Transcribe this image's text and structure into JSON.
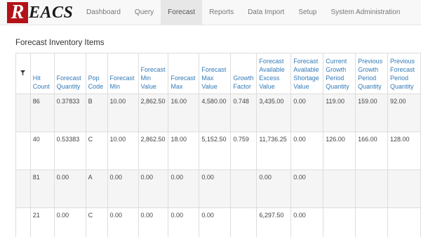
{
  "app": {
    "logo_letter": "R",
    "logo_rest": "EACS"
  },
  "nav": [
    {
      "label": "Dashboard",
      "active": false
    },
    {
      "label": "Query",
      "active": false
    },
    {
      "label": "Forecast",
      "active": true
    },
    {
      "label": "Reports",
      "active": false
    },
    {
      "label": "Data Import",
      "active": false
    },
    {
      "label": "Setup",
      "active": false
    },
    {
      "label": "System Administration",
      "active": false
    }
  ],
  "section": {
    "title": "Forecast Inventory Items"
  },
  "table": {
    "columns": [
      "Hit Count",
      "Forecast Quantity",
      "Pop Code",
      "Forecast Min",
      "Forecast Min Value",
      "Forecast Max",
      "Forecast Max Value",
      "Growth Factor",
      "Forecast Available Excess Value",
      "Forecast Available Shortage Value",
      "Current Growth Period Quantity",
      "Previous Growth Period Quantity",
      "Previous Forecast Period Quantity"
    ],
    "rows": [
      [
        "86",
        "0.37833",
        "B",
        "10.00",
        "2,862.50",
        "16.00",
        "4,580.00",
        "0.748",
        "3,435.00",
        "0.00",
        "119.00",
        "159.00",
        "92.00"
      ],
      [
        "40",
        "0.53383",
        "C",
        "10.00",
        "2,862.50",
        "18.00",
        "5,152.50",
        "0.759",
        "11,736.25",
        "0.00",
        "126.00",
        "166.00",
        "128.00"
      ],
      [
        "81",
        "0.00",
        "A",
        "0.00",
        "0.00",
        "0.00",
        "0.00",
        "",
        "0.00",
        "0.00",
        "",
        "",
        ""
      ],
      [
        "21",
        "0.00",
        "C",
        "0.00",
        "0.00",
        "0.00",
        "0.00",
        "",
        "6,297.50",
        "0.00",
        "",
        "",
        ""
      ]
    ]
  },
  "colors": {
    "link_blue": "#337ab7",
    "logo_red": "#b31217",
    "navbar_bg": "#f8f8f8"
  },
  "icons": {
    "filter": "filter-icon"
  }
}
